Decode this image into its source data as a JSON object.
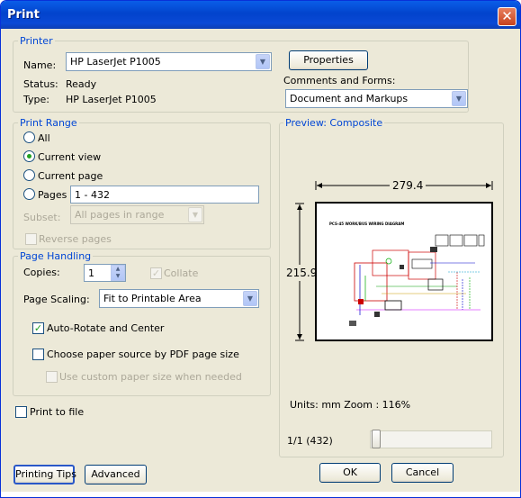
{
  "window": {
    "title": "Print",
    "close_glyph": "✕"
  },
  "printer": {
    "legend": "Printer",
    "name_label": "Name:",
    "name_value": "HP LaserJet P1005",
    "status_label": "Status:",
    "status_value": "Ready",
    "type_label": "Type:",
    "type_value": "HP LaserJet P1005",
    "properties_label": "Properties",
    "comments_label": "Comments and Forms:",
    "comments_value": "Document and Markups"
  },
  "print_range": {
    "legend": "Print Range",
    "all_label": "All",
    "current_view_label": "Current view",
    "current_page_label": "Current page",
    "pages_label": "Pages",
    "pages_value": "1 - 432",
    "subset_label": "Subset:",
    "subset_value": "All pages in range",
    "reverse_label": "Reverse pages",
    "selected": "current_view"
  },
  "page_handling": {
    "legend": "Page Handling",
    "copies_label": "Copies:",
    "copies_value": "1",
    "collate_label": "Collate",
    "scaling_label": "Page Scaling:",
    "scaling_value": "Fit to Printable Area",
    "auto_rotate_label": "Auto-Rotate and Center",
    "auto_rotate_checked": true,
    "paper_source_label": "Choose paper source by PDF page size",
    "paper_source_checked": false,
    "custom_size_label": "Use custom paper size when needed"
  },
  "print_to_file_label": "Print to file",
  "preview": {
    "legend": "Preview: Composite",
    "width_value": "279.4",
    "height_value": "215.9",
    "units_zoom": "Units: mm Zoom : 116%",
    "page_indicator": "1/1 (432)",
    "slider_position": 0.0,
    "doc_heading": "PCS-45 WORK/BUS WIRING DIAGRAM"
  },
  "buttons": {
    "printing_tips": "Printing Tips",
    "advanced": "Advanced",
    "ok": "OK",
    "cancel": "Cancel"
  },
  "colors": {
    "accent": "#0046d5",
    "title_bar": "#0a5ee8",
    "check_green": "#21a121"
  }
}
